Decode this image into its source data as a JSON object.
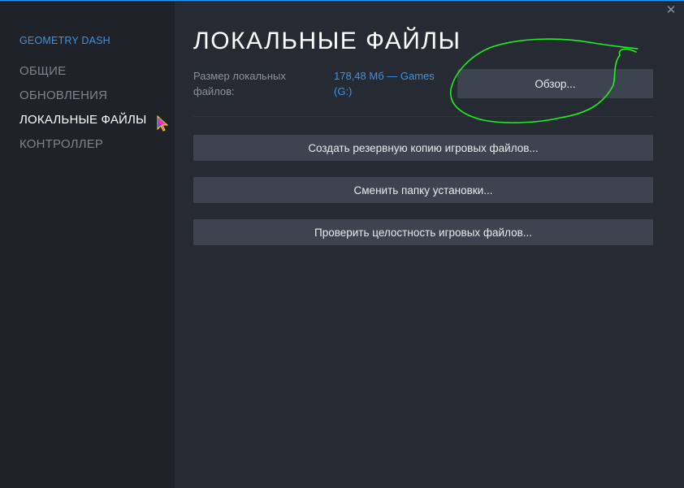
{
  "sidebar": {
    "game_title": "GEOMETRY DASH",
    "items": [
      {
        "label": "ОБЩИЕ",
        "active": false
      },
      {
        "label": "ОБНОВЛЕНИЯ",
        "active": false
      },
      {
        "label": "ЛОКАЛЬНЫЕ ФАЙЛЫ",
        "active": true
      },
      {
        "label": "КОНТРОЛЛЕР",
        "active": false
      }
    ]
  },
  "main": {
    "title": "ЛОКАЛЬНЫЕ ФАЙЛЫ",
    "size_label": "Размер локальных файлов:",
    "size_value": "178,48 Мб — Games (G:)",
    "browse_label": "Обзор...",
    "backup_label": "Создать резервную копию игровых файлов...",
    "move_label": "Сменить папку установки...",
    "verify_label": "Проверить целостность игровых файлов..."
  },
  "window": {
    "close_symbol": "✕"
  },
  "colors": {
    "accent": "#3d94e4",
    "annotation": "#22ee22",
    "background": "#262a32",
    "sidebar": "#1f2229",
    "button": "#3d4450"
  },
  "icons": [
    "close-icon",
    "rainbow-cursor-icon"
  ]
}
